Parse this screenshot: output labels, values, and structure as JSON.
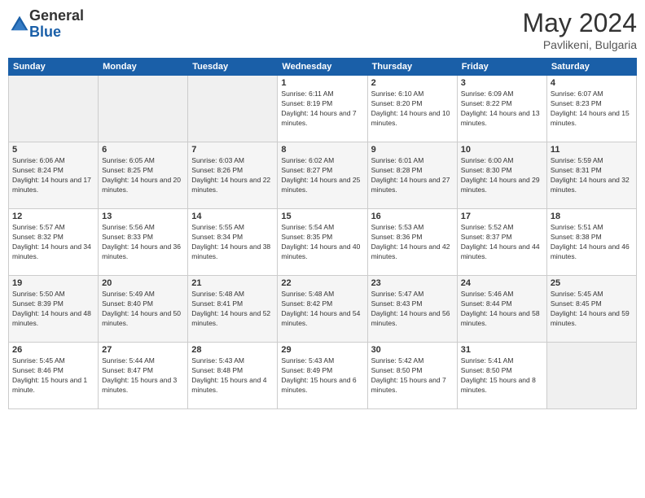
{
  "header": {
    "logo_general": "General",
    "logo_blue": "Blue",
    "title": "May 2024",
    "location": "Pavlikeni, Bulgaria"
  },
  "days_of_week": [
    "Sunday",
    "Monday",
    "Tuesday",
    "Wednesday",
    "Thursday",
    "Friday",
    "Saturday"
  ],
  "weeks": [
    {
      "days": [
        {
          "num": "",
          "info": ""
        },
        {
          "num": "",
          "info": ""
        },
        {
          "num": "",
          "info": ""
        },
        {
          "num": "1",
          "sunrise": "6:11 AM",
          "sunset": "8:19 PM",
          "daylight": "14 hours and 7 minutes."
        },
        {
          "num": "2",
          "sunrise": "6:10 AM",
          "sunset": "8:20 PM",
          "daylight": "14 hours and 10 minutes."
        },
        {
          "num": "3",
          "sunrise": "6:09 AM",
          "sunset": "8:22 PM",
          "daylight": "14 hours and 13 minutes."
        },
        {
          "num": "4",
          "sunrise": "6:07 AM",
          "sunset": "8:23 PM",
          "daylight": "14 hours and 15 minutes."
        }
      ]
    },
    {
      "days": [
        {
          "num": "5",
          "sunrise": "6:06 AM",
          "sunset": "8:24 PM",
          "daylight": "14 hours and 17 minutes."
        },
        {
          "num": "6",
          "sunrise": "6:05 AM",
          "sunset": "8:25 PM",
          "daylight": "14 hours and 20 minutes."
        },
        {
          "num": "7",
          "sunrise": "6:03 AM",
          "sunset": "8:26 PM",
          "daylight": "14 hours and 22 minutes."
        },
        {
          "num": "8",
          "sunrise": "6:02 AM",
          "sunset": "8:27 PM",
          "daylight": "14 hours and 25 minutes."
        },
        {
          "num": "9",
          "sunrise": "6:01 AM",
          "sunset": "8:28 PM",
          "daylight": "14 hours and 27 minutes."
        },
        {
          "num": "10",
          "sunrise": "6:00 AM",
          "sunset": "8:30 PM",
          "daylight": "14 hours and 29 minutes."
        },
        {
          "num": "11",
          "sunrise": "5:59 AM",
          "sunset": "8:31 PM",
          "daylight": "14 hours and 32 minutes."
        }
      ]
    },
    {
      "days": [
        {
          "num": "12",
          "sunrise": "5:57 AM",
          "sunset": "8:32 PM",
          "daylight": "14 hours and 34 minutes."
        },
        {
          "num": "13",
          "sunrise": "5:56 AM",
          "sunset": "8:33 PM",
          "daylight": "14 hours and 36 minutes."
        },
        {
          "num": "14",
          "sunrise": "5:55 AM",
          "sunset": "8:34 PM",
          "daylight": "14 hours and 38 minutes."
        },
        {
          "num": "15",
          "sunrise": "5:54 AM",
          "sunset": "8:35 PM",
          "daylight": "14 hours and 40 minutes."
        },
        {
          "num": "16",
          "sunrise": "5:53 AM",
          "sunset": "8:36 PM",
          "daylight": "14 hours and 42 minutes."
        },
        {
          "num": "17",
          "sunrise": "5:52 AM",
          "sunset": "8:37 PM",
          "daylight": "14 hours and 44 minutes."
        },
        {
          "num": "18",
          "sunrise": "5:51 AM",
          "sunset": "8:38 PM",
          "daylight": "14 hours and 46 minutes."
        }
      ]
    },
    {
      "days": [
        {
          "num": "19",
          "sunrise": "5:50 AM",
          "sunset": "8:39 PM",
          "daylight": "14 hours and 48 minutes."
        },
        {
          "num": "20",
          "sunrise": "5:49 AM",
          "sunset": "8:40 PM",
          "daylight": "14 hours and 50 minutes."
        },
        {
          "num": "21",
          "sunrise": "5:48 AM",
          "sunset": "8:41 PM",
          "daylight": "14 hours and 52 minutes."
        },
        {
          "num": "22",
          "sunrise": "5:48 AM",
          "sunset": "8:42 PM",
          "daylight": "14 hours and 54 minutes."
        },
        {
          "num": "23",
          "sunrise": "5:47 AM",
          "sunset": "8:43 PM",
          "daylight": "14 hours and 56 minutes."
        },
        {
          "num": "24",
          "sunrise": "5:46 AM",
          "sunset": "8:44 PM",
          "daylight": "14 hours and 58 minutes."
        },
        {
          "num": "25",
          "sunrise": "5:45 AM",
          "sunset": "8:45 PM",
          "daylight": "14 hours and 59 minutes."
        }
      ]
    },
    {
      "days": [
        {
          "num": "26",
          "sunrise": "5:45 AM",
          "sunset": "8:46 PM",
          "daylight": "15 hours and 1 minute."
        },
        {
          "num": "27",
          "sunrise": "5:44 AM",
          "sunset": "8:47 PM",
          "daylight": "15 hours and 3 minutes."
        },
        {
          "num": "28",
          "sunrise": "5:43 AM",
          "sunset": "8:48 PM",
          "daylight": "15 hours and 4 minutes."
        },
        {
          "num": "29",
          "sunrise": "5:43 AM",
          "sunset": "8:49 PM",
          "daylight": "15 hours and 6 minutes."
        },
        {
          "num": "30",
          "sunrise": "5:42 AM",
          "sunset": "8:50 PM",
          "daylight": "15 hours and 7 minutes."
        },
        {
          "num": "31",
          "sunrise": "5:41 AM",
          "sunset": "8:50 PM",
          "daylight": "15 hours and 8 minutes."
        },
        {
          "num": "",
          "info": ""
        }
      ]
    }
  ],
  "labels": {
    "sunrise_prefix": "Sunrise: ",
    "sunset_prefix": "Sunset: ",
    "daylight_prefix": "Daylight: "
  }
}
